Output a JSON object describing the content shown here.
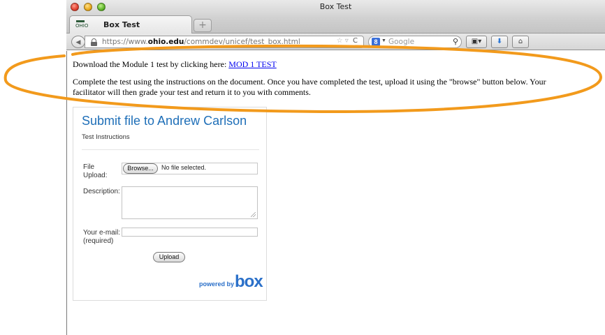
{
  "window": {
    "title": "Box Test"
  },
  "tabs": [
    {
      "label": "Box Test",
      "favicon_text": "OHIO"
    }
  ],
  "new_tab": {
    "label": "+"
  },
  "navbar": {
    "url_prefix": "https://www.",
    "url_domain": "ohio.edu",
    "url_path": "/commdev/unicef/test_box.html",
    "search_placeholder": "Google",
    "search_engine_letter": "8"
  },
  "page": {
    "download_prefix": "Download the Module 1 test by clicking here: ",
    "download_link": "MOD 1 TEST",
    "instructions": "Complete the test using the instructions on the document. Once you have completed the test, upload it using the \"browse\" button below. Your facilitator will then grade your test and return it to you with comments."
  },
  "form": {
    "title": "Submit file to Andrew Carlson",
    "subtitle": "Test Instructions",
    "file_label_line1": "File",
    "file_label_line2": "Upload:",
    "browse_label": "Browse...",
    "file_status": "No file selected.",
    "description_label": "Description:",
    "email_label_line1": "Your e-mail:",
    "email_label_line2": "(required)",
    "upload_label": "Upload",
    "powered_by": "powered by",
    "logo_text": "box"
  },
  "colors": {
    "annotation": "#f29a1c",
    "form_title": "#1f6fb8",
    "link": "#0000ee"
  }
}
